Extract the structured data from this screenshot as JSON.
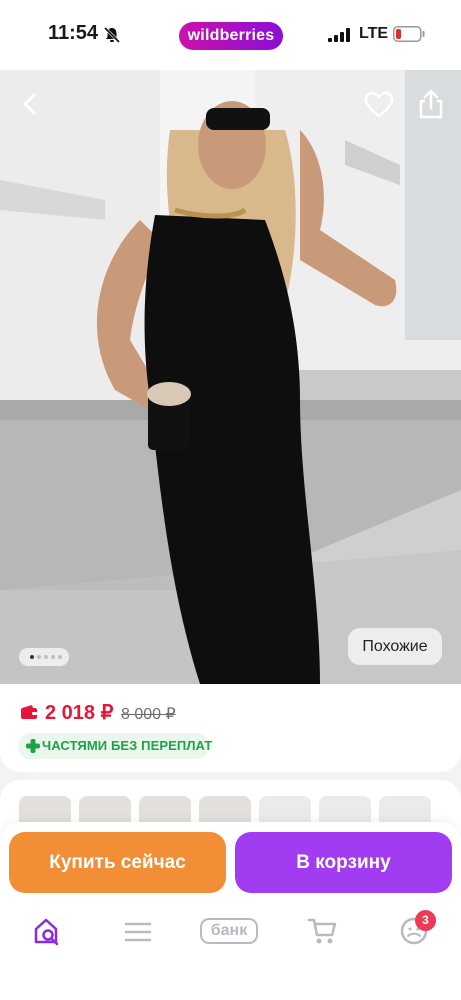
{
  "status_bar": {
    "time": "11:54",
    "network": "LTE",
    "brand": "wildberries",
    "icons": [
      "bell-muted-icon",
      "signal-icon",
      "battery-low-icon"
    ]
  },
  "product": {
    "photo_pager": {
      "count": 5,
      "active_index": 0
    },
    "similar_label": "Похожие",
    "price": "2 018 ₽",
    "old_price": "8 000 ₽",
    "installment_badge": "ЧАСТЯМИ БЕЗ ПЕРЕПЛАТ"
  },
  "actions": {
    "buy_now": "Купить сейчас",
    "add_to_cart": "В корзину"
  },
  "tabbar": {
    "bank_label": "банк",
    "profile_badge": "3",
    "icons": [
      "home-search-icon",
      "menu-icon",
      "bank-icon",
      "cart-icon",
      "profile-icon"
    ]
  },
  "colors": {
    "brand_gradient_start": "#cb11ab",
    "brand_gradient_end": "#8a0fd6",
    "price_red": "#e4173a",
    "buy_orange": "#f18e36",
    "cart_purple": "#a23cf0",
    "installment_green": "#23a04a",
    "active_tab": "#8a2be2"
  }
}
